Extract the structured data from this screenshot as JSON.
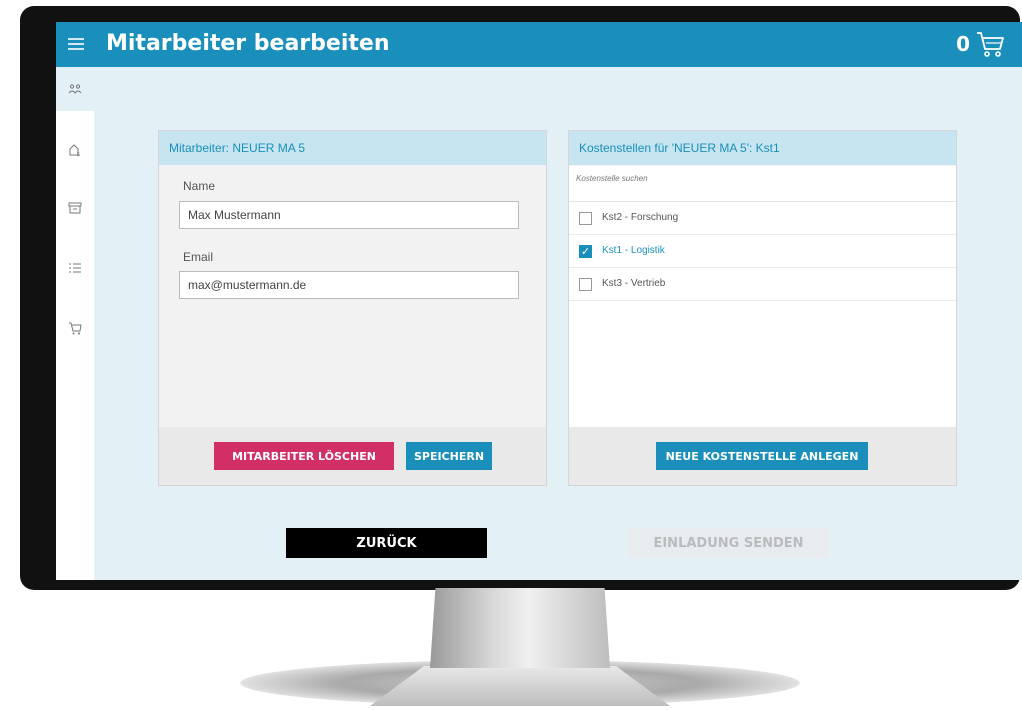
{
  "header": {
    "title": "Mitarbeiter bearbeiten",
    "cart_count": "0"
  },
  "sidebar": {
    "items": [
      {
        "icon": "users-icon"
      },
      {
        "icon": "cost-center-icon"
      },
      {
        "icon": "archive-icon"
      },
      {
        "icon": "list-icon"
      },
      {
        "icon": "cart-icon"
      }
    ]
  },
  "employee_panel": {
    "title": "Mitarbeiter: NEUER MA 5",
    "name_label": "Name",
    "name_value": "Max Mustermann",
    "email_label": "Email",
    "email_value": "max@mustermann.de",
    "delete_label": "MITARBEITER LÖSCHEN",
    "save_label": "SPEICHERN"
  },
  "cost_panel": {
    "title": "Kostenstellen für 'NEUER MA 5': Kst1",
    "search_placeholder": "Kostenstelle suchen",
    "items": [
      {
        "label": "Kst2 - Forschung",
        "checked": false
      },
      {
        "label": "Kst1 - Logistik",
        "checked": true
      },
      {
        "label": "Kst3 - Vertrieb",
        "checked": false
      }
    ],
    "new_label": "NEUE KOSTENSTELLE ANLEGEN"
  },
  "footer": {
    "back_label": "ZURÜCK",
    "invite_label": "EINLADUNG SENDEN"
  },
  "colors": {
    "accent": "#1a8fbc",
    "danger": "#d12f66",
    "background": "#e3f1f7"
  }
}
